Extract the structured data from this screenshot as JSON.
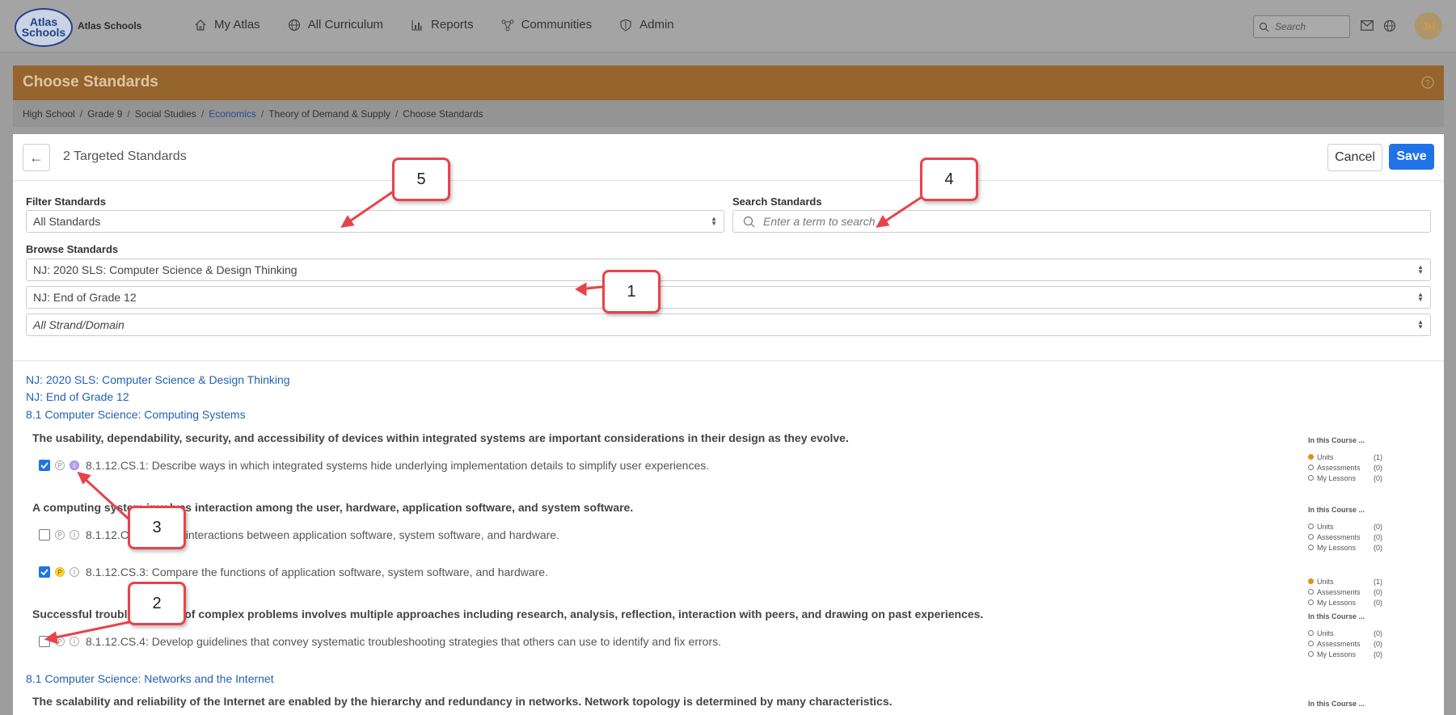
{
  "nav": {
    "logo_line1": "Atlas",
    "logo_line2": "Schools",
    "brand": "Atlas Schools",
    "items": [
      {
        "label": "My Atlas",
        "icon": "home-icon"
      },
      {
        "label": "All Curriculum",
        "icon": "globe-icon"
      },
      {
        "label": "Reports",
        "icon": "bar-chart-icon"
      },
      {
        "label": "Communities",
        "icon": "network-icon"
      },
      {
        "label": "Admin",
        "icon": "shield-icon"
      }
    ],
    "search_placeholder": "Search",
    "avatar_initials": "JH"
  },
  "header": {
    "title": "Choose Standards",
    "breadcrumb": [
      "High School",
      "Grade 9",
      "Social Studies",
      "Economics",
      "Theory of Demand & Supply",
      "Choose Standards"
    ]
  },
  "panel": {
    "targeted_label": "2 Targeted Standards",
    "cancel_label": "Cancel",
    "save_label": "Save",
    "filter_label": "Filter Standards",
    "filter_value": "All Standards",
    "search_label": "Search Standards",
    "search_placeholder": "Enter a term to search",
    "browse_label": "Browse Standards",
    "browse_set": "NJ: 2020 SLS: Computer Science & Design Thinking",
    "browse_grade": "NJ: End of Grade 12",
    "browse_strand": "All Strand/Domain"
  },
  "standards": {
    "set_title": "NJ: 2020 SLS: Computer Science & Design Thinking",
    "grade_title": "NJ: End of Grade 12",
    "section1": "8.1 Computer Science: Computing Systems",
    "group1": "The usability, dependability, security, and accessibility of devices within integrated systems are important considerations in their design as they evolve.",
    "group2": "A computing system involves interaction among the user, hardware, application software, and system software.",
    "group3": "Successful troubleshooting of complex problems involves multiple approaches including research, analysis, reflection, interaction with peers, and drawing on past experiences.",
    "section2": "8.1 Computer Science: Networks and the Internet",
    "group4": "The scalability and reliability of the Internet are enabled by the hierarchy and redundancy in networks. Network topology is determined by many characteristics.",
    "items": [
      {
        "code": "8.1.12.CS.1",
        "text": "8.1.12.CS.1: Describe ways in which integrated systems hide underlying implementation details to simplify user experiences.",
        "checked": true
      },
      {
        "code": "8.1.12.CS.2",
        "text": "8.1.12.CS.2: Model interactions between application software, system software, and hardware.",
        "checked": false
      },
      {
        "code": "8.1.12.CS.3",
        "text": "8.1.12.CS.3: Compare the functions of application software, system software, and hardware.",
        "checked": true
      },
      {
        "code": "8.1.12.CS.4",
        "text": "8.1.12.CS.4: Develop guidelines that convey systematic troubleshooting strategies that others can use to identify and fix errors.",
        "checked": false
      }
    ],
    "badge_p": "P",
    "badge_i": "I",
    "in_course_header": "In this Course ...",
    "in_course_units": "Units",
    "in_course_assessments": "Assessments",
    "in_course_lessons": "My Lessons",
    "counts": [
      {
        "units": "(1)",
        "assessments": "(0)",
        "lessons": "(0)"
      },
      {
        "units": "(0)",
        "assessments": "(0)",
        "lessons": "(0)"
      },
      {
        "units": "(1)",
        "assessments": "(0)",
        "lessons": "(0)"
      },
      {
        "units": "(0)",
        "assessments": "(0)",
        "lessons": "(0)"
      }
    ]
  },
  "callouts": [
    "1",
    "2",
    "3",
    "4",
    "5"
  ],
  "colors": {
    "accent": "#1f73e6",
    "header_band": "#95652d",
    "callout_border": "#e8434b",
    "link": "#2261b3"
  }
}
